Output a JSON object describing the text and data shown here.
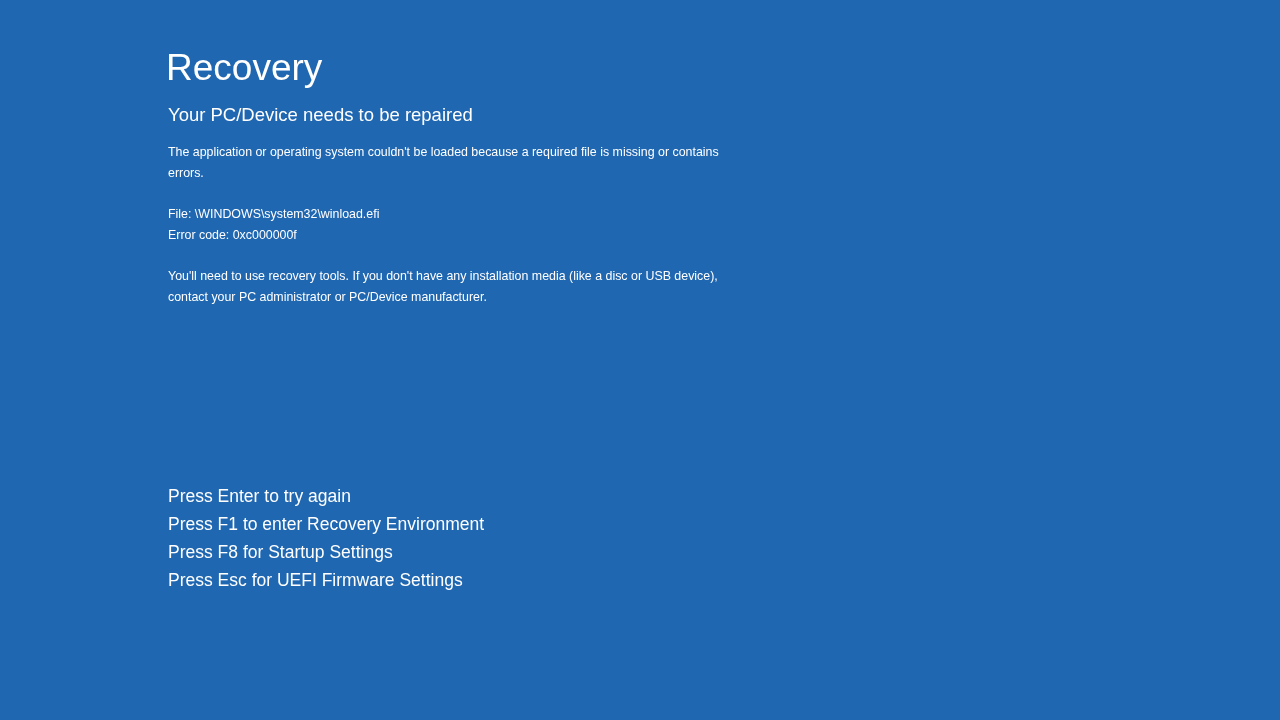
{
  "title": "Recovery",
  "subtitle": "Your PC/Device needs to be repaired",
  "message_blocks": [
    {
      "lines": [
        "The application or operating system couldn't be loaded because a required file is missing or contains errors."
      ]
    },
    {
      "lines": [
        "File: \\WINDOWS\\system32\\winload.efi",
        "Error code: 0xc000000f"
      ]
    },
    {
      "lines": [
        "You'll need to use recovery tools. If you don't have any installation media (like a disc or USB device), contact your PC administrator or PC/Device manufacturer."
      ]
    }
  ],
  "key_options": [
    "Press Enter to try again",
    "Press F1 to enter Recovery Environment",
    "Press F8 for Startup Settings",
    "Press Esc for UEFI Firmware Settings"
  ]
}
